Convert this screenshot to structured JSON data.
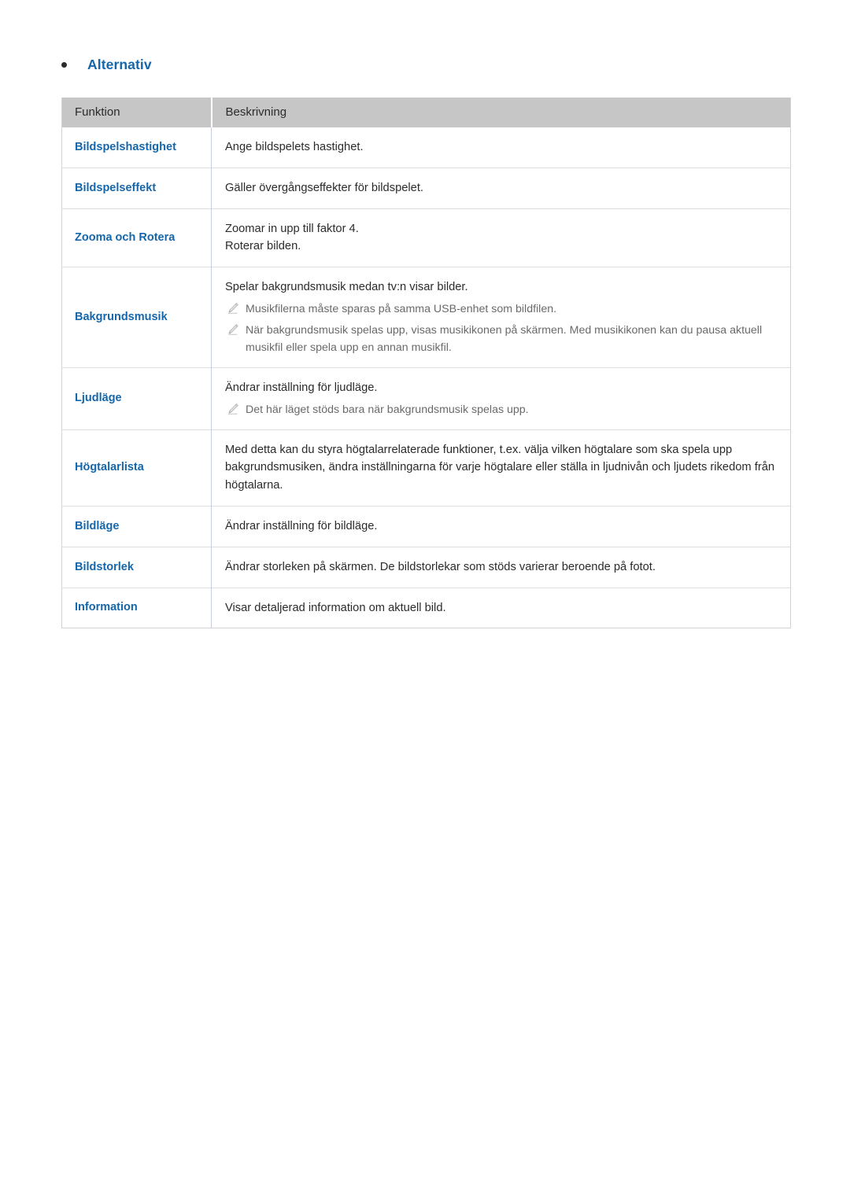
{
  "section": {
    "bullet_icon": "bullet-dot-icon",
    "heading": "Alternativ"
  },
  "colors": {
    "accent_blue": "#1566aa",
    "header_bg": "#c6c6c6",
    "body_text": "#2b2b2b",
    "note_text": "#6a6a6a",
    "row_border": "#dddddd",
    "column_divider": "#c9cde3"
  },
  "table": {
    "columns": [
      "Funktion",
      "Beskrivning"
    ],
    "rows": [
      {
        "function": "Bildspelshastighet",
        "lines": [
          "Ange bildspelets hastighet."
        ],
        "notes": []
      },
      {
        "function": "Bildspelseffekt",
        "lines": [
          "Gäller övergångseffekter för bildspelet."
        ],
        "notes": []
      },
      {
        "function": "Zooma och Rotera",
        "lines": [
          "Zoomar in upp till faktor 4.",
          "Roterar bilden."
        ],
        "notes": []
      },
      {
        "function": "Bakgrundsmusik",
        "lines": [
          "Spelar bakgrundsmusik medan tv:n visar bilder."
        ],
        "notes": [
          "Musikfilerna måste sparas på samma USB-enhet som bildfilen.",
          "När bakgrundsmusik spelas upp, visas musikikonen på skärmen. Med musikikonen kan du pausa aktuell musikfil eller spela upp en annan musikfil."
        ]
      },
      {
        "function": "Ljudläge",
        "lines": [
          "Ändrar inställning för ljudläge."
        ],
        "notes": [
          "Det här läget stöds bara när bakgrundsmusik spelas upp."
        ]
      },
      {
        "function": "Högtalarlista",
        "lines": [
          "Med detta kan du styra högtalarrelaterade funktioner, t.ex. välja vilken högtalare som ska spela upp bakgrundsmusiken, ändra inställningarna för varje högtalare eller ställa in ljudnivån och ljudets rikedom från högtalarna."
        ],
        "notes": []
      },
      {
        "function": "Bildläge",
        "lines": [
          "Ändrar inställning för bildläge."
        ],
        "notes": []
      },
      {
        "function": "Bildstorlek",
        "lines": [
          "Ändrar storleken på skärmen. De bildstorlekar som stöds varierar beroende på fotot."
        ],
        "notes": []
      },
      {
        "function": "Information",
        "lines": [
          "Visar detaljerad information om aktuell bild."
        ],
        "notes": []
      }
    ]
  }
}
